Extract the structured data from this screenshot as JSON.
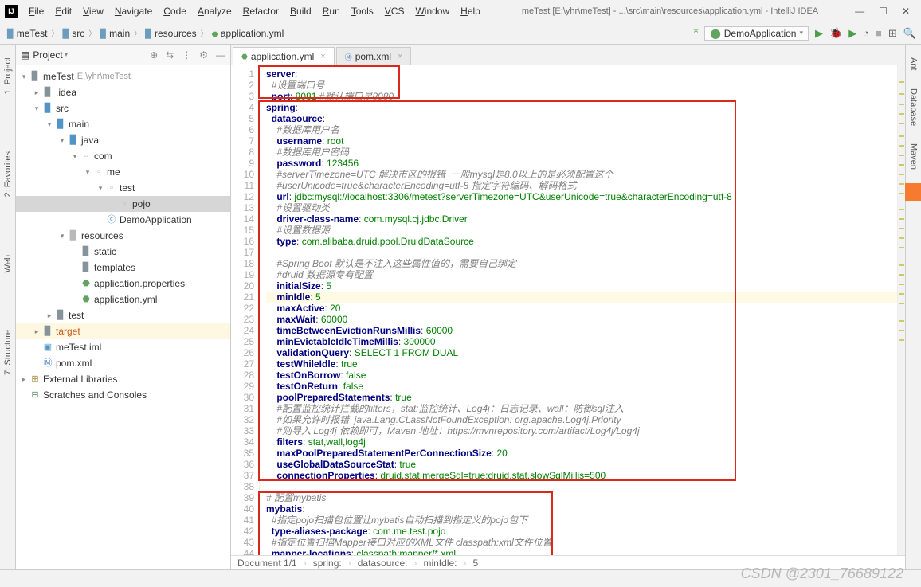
{
  "window": {
    "title": "meTest [E:\\yhr\\meTest] - ...\\src\\main\\resources\\application.yml - IntelliJ IDEA"
  },
  "menu": [
    "File",
    "Edit",
    "View",
    "Navigate",
    "Code",
    "Analyze",
    "Refactor",
    "Build",
    "Run",
    "Tools",
    "VCS",
    "Window",
    "Help"
  ],
  "runconfig": "DemoApplication",
  "breadcrumb": [
    "meTest",
    "src",
    "main",
    "resources",
    "application.yml"
  ],
  "project_panel": {
    "title": "Project"
  },
  "side_tabs_left": [
    "1: Project",
    "2: Favorites",
    "Web",
    "7: Structure"
  ],
  "side_tabs_right": [
    "Ant",
    "Database",
    "Maven"
  ],
  "tree": {
    "root": "meTest",
    "root_path": "E:\\yhr\\meTest",
    "idea": ".idea",
    "src": "src",
    "main": "main",
    "java": "java",
    "com": "com",
    "me": "me",
    "test_pkg": "test",
    "pojo": "pojo",
    "demo_app": "DemoApplication",
    "resources": "resources",
    "static": "static",
    "templates": "templates",
    "app_props": "application.properties",
    "app_yml": "application.yml",
    "test_dir": "test",
    "target": "target",
    "iml": "meTest.iml",
    "pom": "pom.xml",
    "ext_lib": "External Libraries",
    "scratches": "Scratches and Consoles"
  },
  "editor_tabs": [
    {
      "label": "application.yml",
      "icon": "yaml"
    },
    {
      "label": "pom.xml",
      "icon": "xml"
    }
  ],
  "lines": [
    {
      "n": 1,
      "ind": 0,
      "k": "server",
      "c": ":"
    },
    {
      "n": 2,
      "ind": 1,
      "comment": "#设置端口号"
    },
    {
      "n": 3,
      "ind": 1,
      "k": "port",
      "c": ": ",
      "v": "8081",
      "tail": " #默认端口是8080",
      "tailc": true
    },
    {
      "n": 4,
      "ind": 0,
      "k": "spring",
      "c": ":"
    },
    {
      "n": 5,
      "ind": 1,
      "k": "datasource",
      "c": ":"
    },
    {
      "n": 6,
      "ind": 2,
      "comment": "#数据库用户名"
    },
    {
      "n": 7,
      "ind": 2,
      "k": "username",
      "c": ": ",
      "v": "root"
    },
    {
      "n": 8,
      "ind": 2,
      "comment": "#数据库用户密码"
    },
    {
      "n": 9,
      "ind": 2,
      "k": "password",
      "c": ": ",
      "v": "123456"
    },
    {
      "n": 10,
      "ind": 2,
      "comment": "#serverTimezone=UTC 解决市区的报错  一般mysql是8.0以上的是必须配置这个"
    },
    {
      "n": 11,
      "ind": 2,
      "comment": "#userUnicode=true&characterEncoding=utf-8 指定字符编码、解码格式"
    },
    {
      "n": 12,
      "ind": 2,
      "k": "url",
      "c": ": ",
      "v": "jdbc:mysql://localhost:3306/metest?serverTimezone=UTC&userUnicode=true&characterEncoding=utf-8"
    },
    {
      "n": 13,
      "ind": 2,
      "comment": "#设置驱动类"
    },
    {
      "n": 14,
      "ind": 2,
      "k": "driver-class-name",
      "c": ": ",
      "v": "com.mysql.cj.jdbc.Driver"
    },
    {
      "n": 15,
      "ind": 2,
      "comment": "#设置数据源"
    },
    {
      "n": 16,
      "ind": 2,
      "k": "type",
      "c": ": ",
      "v": "com.alibaba.druid.pool.DruidDataSource"
    },
    {
      "n": 17,
      "ind": 2,
      "blank": true
    },
    {
      "n": 18,
      "ind": 2,
      "comment": "#Spring Boot 默认是不注入这些属性值的，需要自己绑定"
    },
    {
      "n": 19,
      "ind": 2,
      "comment": "#druid 数据源专有配置"
    },
    {
      "n": 20,
      "ind": 2,
      "k": "initialSize",
      "c": ": ",
      "v": "5"
    },
    {
      "n": 21,
      "ind": 2,
      "k": "minIdle",
      "c": ": ",
      "v": "5",
      "hl": true
    },
    {
      "n": 22,
      "ind": 2,
      "k": "maxActive",
      "c": ": ",
      "v": "20"
    },
    {
      "n": 23,
      "ind": 2,
      "k": "maxWait",
      "c": ": ",
      "v": "60000"
    },
    {
      "n": 24,
      "ind": 2,
      "k": "timeBetweenEvictionRunsMillis",
      "c": ": ",
      "v": "60000"
    },
    {
      "n": 25,
      "ind": 2,
      "k": "minEvictableIdleTimeMillis",
      "c": ": ",
      "v": "300000"
    },
    {
      "n": 26,
      "ind": 2,
      "k": "validationQuery",
      "c": ": ",
      "v": "SELECT 1 FROM DUAL"
    },
    {
      "n": 27,
      "ind": 2,
      "k": "testWhileIdle",
      "c": ": ",
      "v": "true"
    },
    {
      "n": 28,
      "ind": 2,
      "k": "testOnBorrow",
      "c": ": ",
      "v": "false"
    },
    {
      "n": 29,
      "ind": 2,
      "k": "testOnReturn",
      "c": ": ",
      "v": "false"
    },
    {
      "n": 30,
      "ind": 2,
      "k": "poolPreparedStatements",
      "c": ": ",
      "v": "true"
    },
    {
      "n": 31,
      "ind": 2,
      "comment": "#配置监控统计拦截的filters，stat:监控统计、Log4j：日志记录、wall：防御sql注入"
    },
    {
      "n": 32,
      "ind": 2,
      "comment": "#如果允许时报错  java.Lang.CLassNotFoundException: org.apache.Log4j.Priority"
    },
    {
      "n": 33,
      "ind": 2,
      "comment": "#则导入 Log4j 依赖即可，Maven 地址：https://mvnrepository.com/artifact/Log4j/Log4j"
    },
    {
      "n": 34,
      "ind": 2,
      "k": "filters",
      "c": ": ",
      "v": "stat,wall,log4j"
    },
    {
      "n": 35,
      "ind": 2,
      "k": "maxPoolPreparedStatementPerConnectionSize",
      "c": ": ",
      "v": "20"
    },
    {
      "n": 36,
      "ind": 2,
      "k": "useGlobalDataSourceStat",
      "c": ": ",
      "v": "true"
    },
    {
      "n": 37,
      "ind": 2,
      "k": "connectionProperties",
      "c": ": ",
      "v": "druid.stat.mergeSql=true;druid.stat.slowSqlMillis=500"
    },
    {
      "n": 38,
      "ind": 0,
      "blank": true
    },
    {
      "n": 39,
      "ind": 0,
      "comment": "# 配置mybatis"
    },
    {
      "n": 40,
      "ind": 0,
      "k": "mybatis",
      "c": ":"
    },
    {
      "n": 41,
      "ind": 1,
      "comment": "#指定pojo扫描包位置让mybatis自动扫描到指定义的pojo包下"
    },
    {
      "n": 42,
      "ind": 1,
      "k": "type-aliases-package",
      "c": ": ",
      "v": "com.me.test.pojo"
    },
    {
      "n": 43,
      "ind": 1,
      "comment": "#指定位置扫描Mapper接口对应的XML文件 classpath:xml文件位置"
    },
    {
      "n": 44,
      "ind": 1,
      "k": "mapper-locations",
      "c": ": ",
      "v": "classpath:mapper/*.xml"
    }
  ],
  "navbar": {
    "doc": "Document 1/1",
    "path": [
      "spring:",
      "datasource:",
      "minIdle:",
      "5"
    ]
  },
  "watermark": "CSDN @2301_76689122"
}
